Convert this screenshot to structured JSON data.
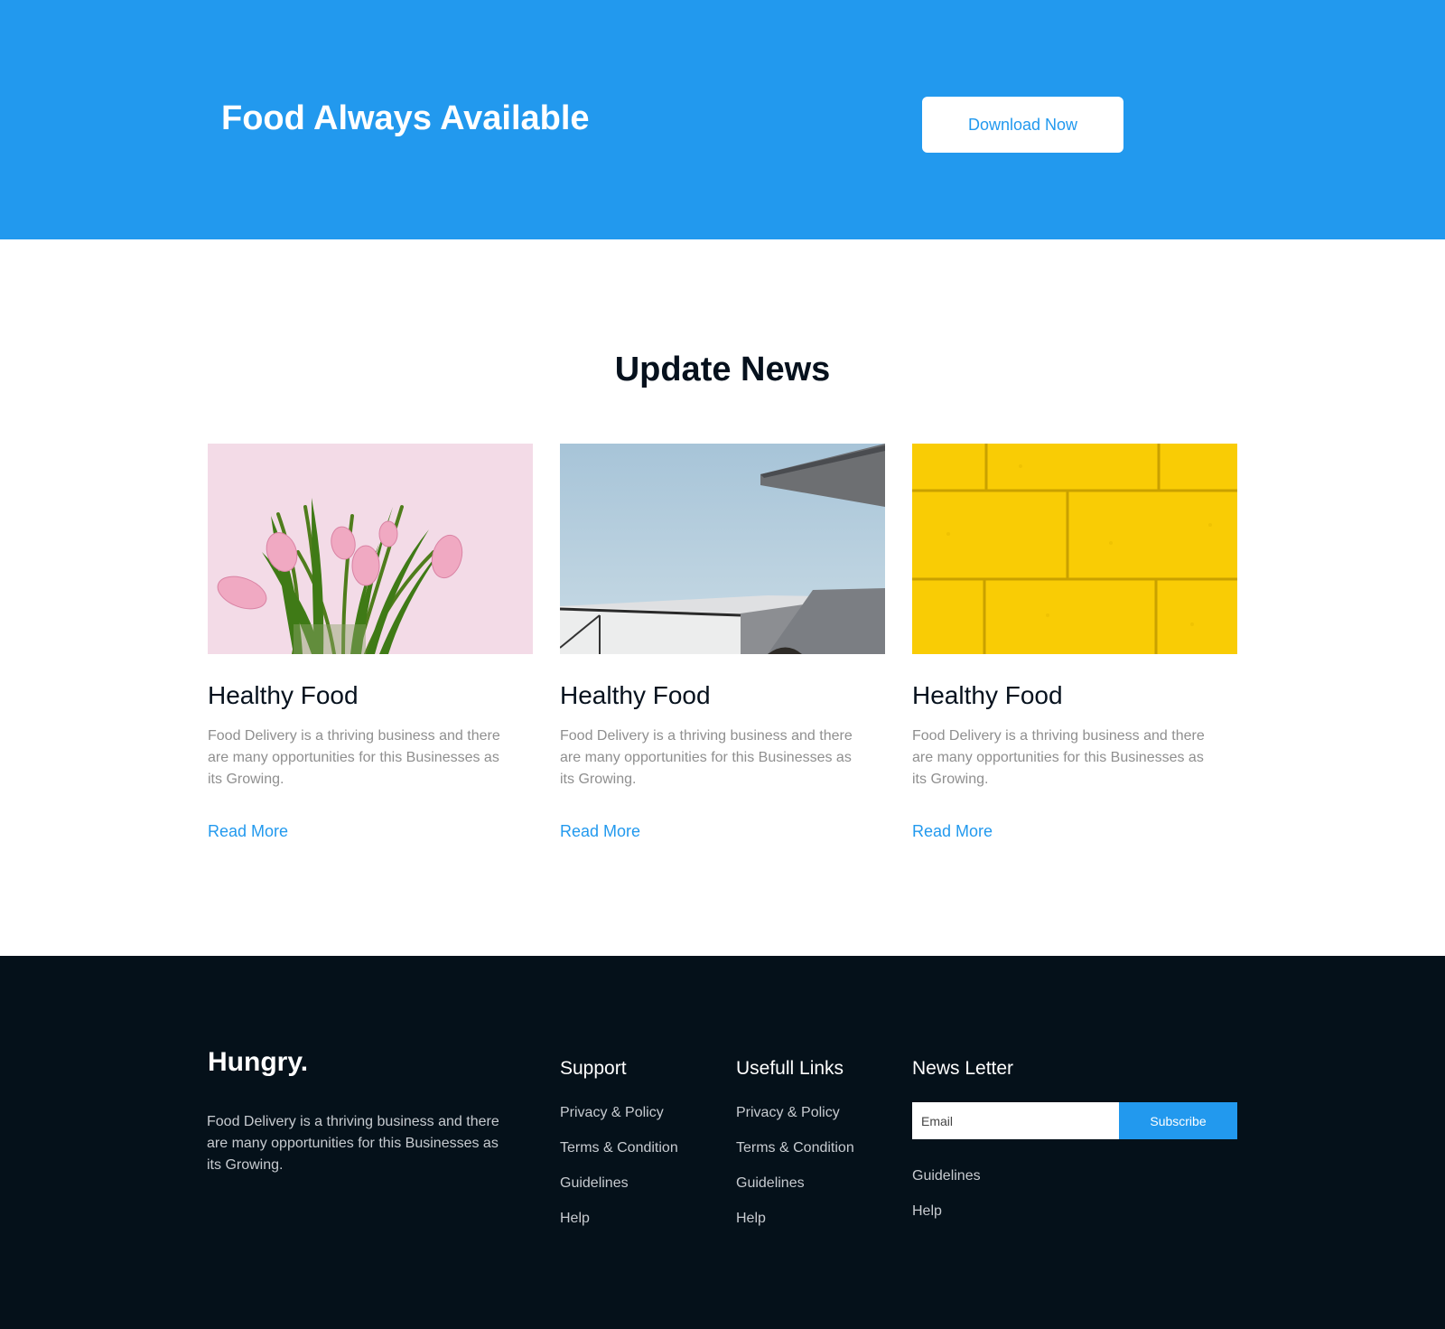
{
  "hero": {
    "title": "Food Always Available",
    "button_label": "Download Now",
    "background_color": "#2299ee"
  },
  "news": {
    "title": "Update News",
    "cards": [
      {
        "image": "pink-tulips-image",
        "title": "Healthy Food",
        "text": "Food Delivery is a thriving business and there are many opportunities for this Businesses as its Growing.",
        "link": "Read More"
      },
      {
        "image": "building-sky-image",
        "title": "Healthy Food",
        "text": "Food Delivery is a thriving business and there are many opportunities for this Businesses as its Growing.",
        "link": "Read More"
      },
      {
        "image": "yellow-brick-wall-image",
        "title": "Healthy Food",
        "text": "Food Delivery is a thriving business and there are many opportunities for this Businesses as its Growing.",
        "link": "Read More"
      }
    ]
  },
  "footer": {
    "brand": "Hungry.",
    "about": "Food Delivery is a thriving business and there are many opportunities for this Businesses as its Growing.",
    "support": {
      "heading": "Support",
      "links": [
        "Privacy & Policy",
        "Terms & Condition",
        "Guidelines",
        "Help"
      ]
    },
    "useful_links": {
      "heading": "Usefull Links",
      "links": [
        "Privacy & Policy",
        "Terms & Condition",
        "Guidelines",
        "Help"
      ]
    },
    "newsletter": {
      "heading": "News Letter",
      "email_placeholder": "Email",
      "subscribe_label": "Subscribe",
      "links": [
        "Guidelines",
        "Help"
      ]
    },
    "background_color": "#05111a"
  },
  "accent_color": "#2299ee"
}
